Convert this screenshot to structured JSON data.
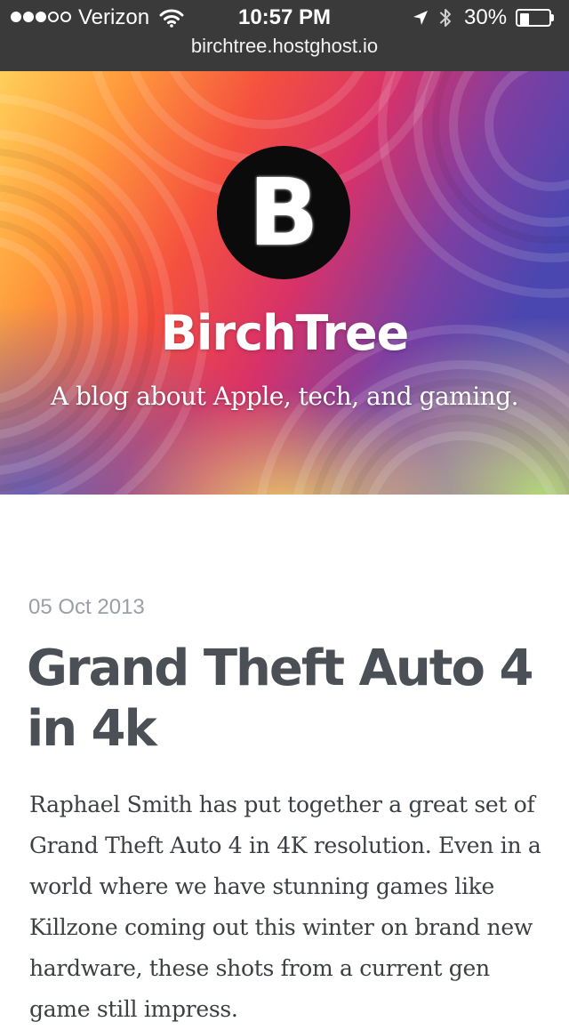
{
  "status_bar": {
    "signal_dots": [
      true,
      true,
      true,
      false,
      false
    ],
    "carrier": "Verizon",
    "time": "10:57 PM",
    "battery_percent": "30%",
    "battery_level": 0.3,
    "icons": [
      "wifi-icon",
      "location-icon",
      "bluetooth-icon",
      "battery-icon"
    ]
  },
  "browser": {
    "url": "birchtree.hostghost.io"
  },
  "header": {
    "logo_letter": "B",
    "title": "BirchTree",
    "tagline": "A blog about Apple, tech, and gaming."
  },
  "post": {
    "date": "05 Oct 2013",
    "title": "Grand Theft Auto 4 in 4k",
    "excerpt": "Raphael Smith has put together a great set of Grand Theft Auto 4 in 4K resolution. Even in a world where we have stunning games like Killzone coming out this winter on brand new hardware, these shots from a current gen game still impress."
  },
  "colors": {
    "status_bar_bg": "#3a3a3a",
    "date_text": "#9aa0a6",
    "title_text": "#4a5055",
    "body_text": "#3c4043"
  }
}
